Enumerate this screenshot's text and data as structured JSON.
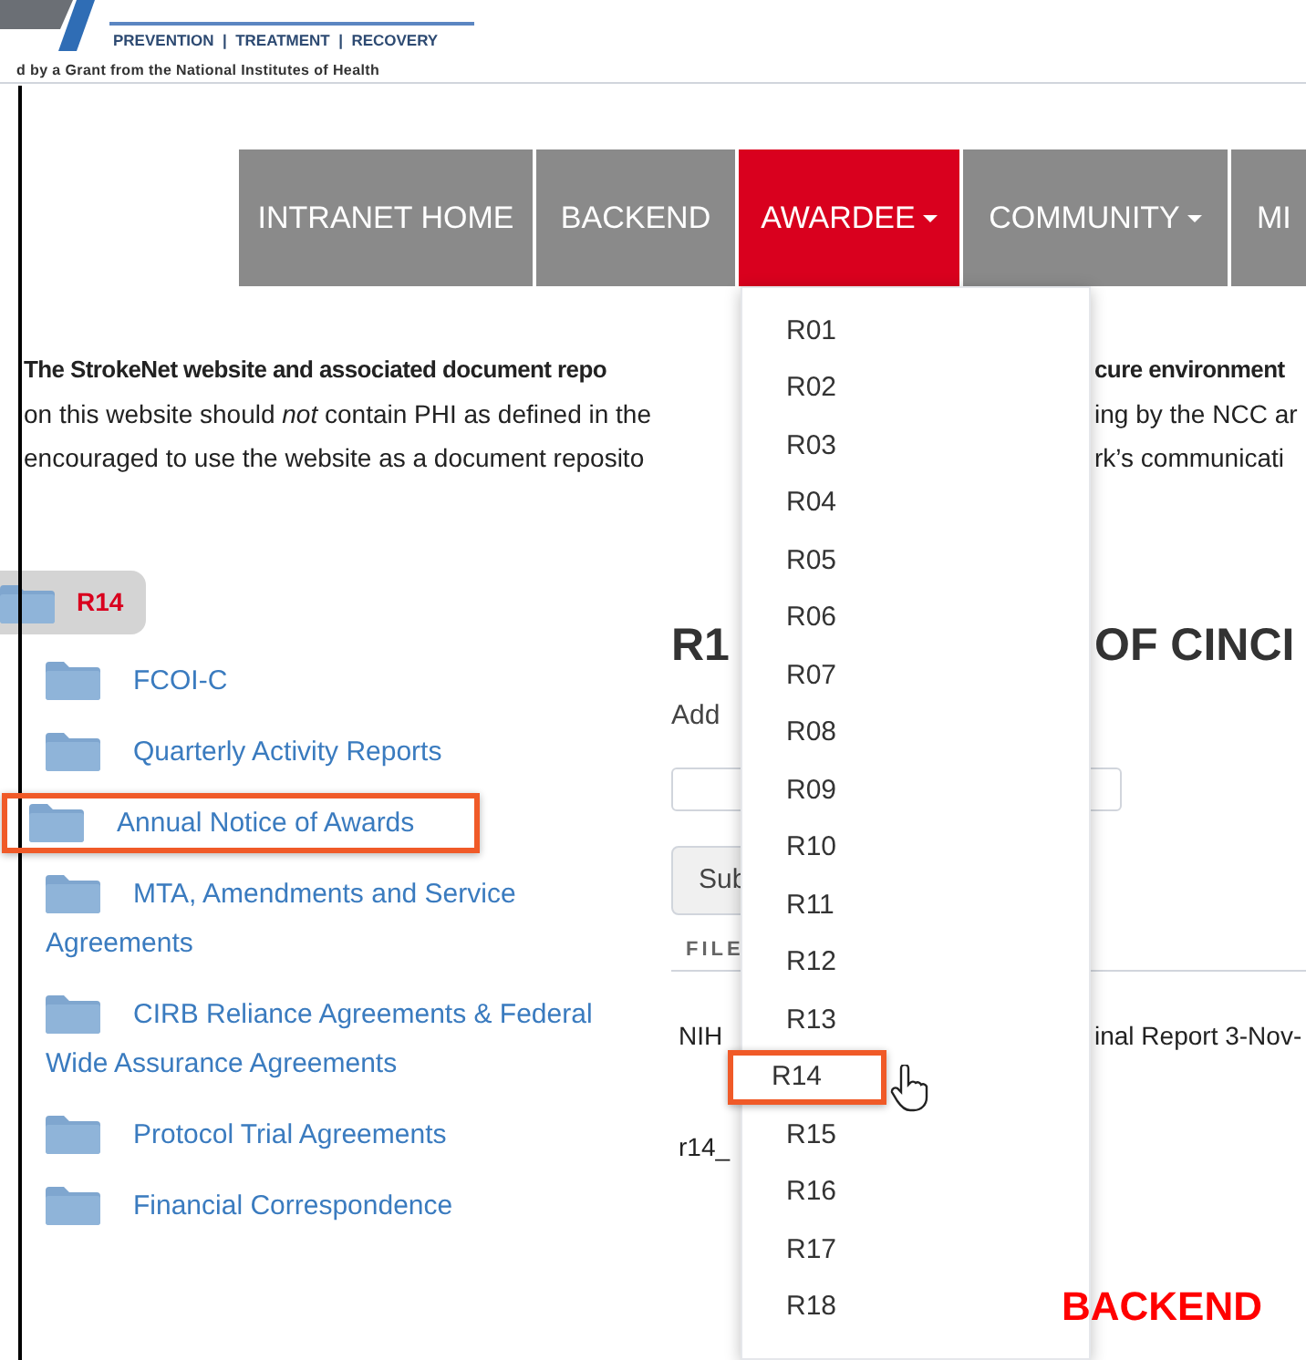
{
  "header": {
    "tagline": "PREVENTION  |  TREATMENT  |  RECOVERY",
    "grant_line": "d by a Grant from the National Institutes of Health"
  },
  "nav": {
    "tabs": [
      {
        "label": "INTRANET HOME",
        "selected": false,
        "dropdown": false
      },
      {
        "label": "BACKEND",
        "selected": false,
        "dropdown": false
      },
      {
        "label": "AWARDEE",
        "selected": true,
        "dropdown": true
      },
      {
        "label": "COMMUNITY",
        "selected": false,
        "dropdown": true
      },
      {
        "label": "MI",
        "selected": false,
        "dropdown": false
      }
    ]
  },
  "notice": [
    {
      "left": "The StrokeNet website and associated document repo",
      "right": "cure environment",
      "bold": true
    },
    {
      "left": "on this website should *not* contain PHI as defined in the",
      "right": "ing by the NCC ar",
      "bold": false
    },
    {
      "left": "encouraged to use the website as a document reposito",
      "right": "rk’s communicati",
      "bold": false
    }
  ],
  "sidebar": {
    "current": "R14",
    "folders": [
      {
        "label": "FCOI-C",
        "callout": false
      },
      {
        "label": "Quarterly Activity Reports",
        "callout": false
      },
      {
        "label": "Annual Notice of Awards",
        "callout": true
      },
      {
        "label": "MTA, Amendments and Service Agreements",
        "callout": false
      },
      {
        "label": "CIRB Reliance Agreements & Federal Wide Assurance Agreements",
        "callout": false
      },
      {
        "label": "Protocol Trial Agreements",
        "callout": false
      },
      {
        "label": "Financial Correspondence",
        "callout": false
      }
    ]
  },
  "main": {
    "title_left": "R1",
    "title_right": "OF CINCI",
    "add_text": "Add",
    "button": "Sub",
    "column": "FILE",
    "rows": [
      {
        "left": "NIH",
        "right": "inal Report 3-Nov-"
      },
      {
        "left": "r14_"
      }
    ]
  },
  "dropdown": {
    "items": [
      {
        "label": "R01",
        "callout": false
      },
      {
        "label": "R02",
        "callout": false
      },
      {
        "label": "R03",
        "callout": false
      },
      {
        "label": "R04",
        "callout": false
      },
      {
        "label": "R05",
        "callout": false
      },
      {
        "label": "R06",
        "callout": false
      },
      {
        "label": "R07",
        "callout": false
      },
      {
        "label": "R08",
        "callout": false
      },
      {
        "label": "R09",
        "callout": false
      },
      {
        "label": "R10",
        "callout": false
      },
      {
        "label": "R11",
        "callout": false
      },
      {
        "label": "R12",
        "callout": false
      },
      {
        "label": "R13",
        "callout": false
      },
      {
        "label": "R14",
        "callout": true
      },
      {
        "label": "R15",
        "callout": false
      },
      {
        "label": "R16",
        "callout": false
      },
      {
        "label": "R17",
        "callout": false
      },
      {
        "label": "R18",
        "callout": false
      }
    ]
  },
  "annotation_label": "BACKEND"
}
